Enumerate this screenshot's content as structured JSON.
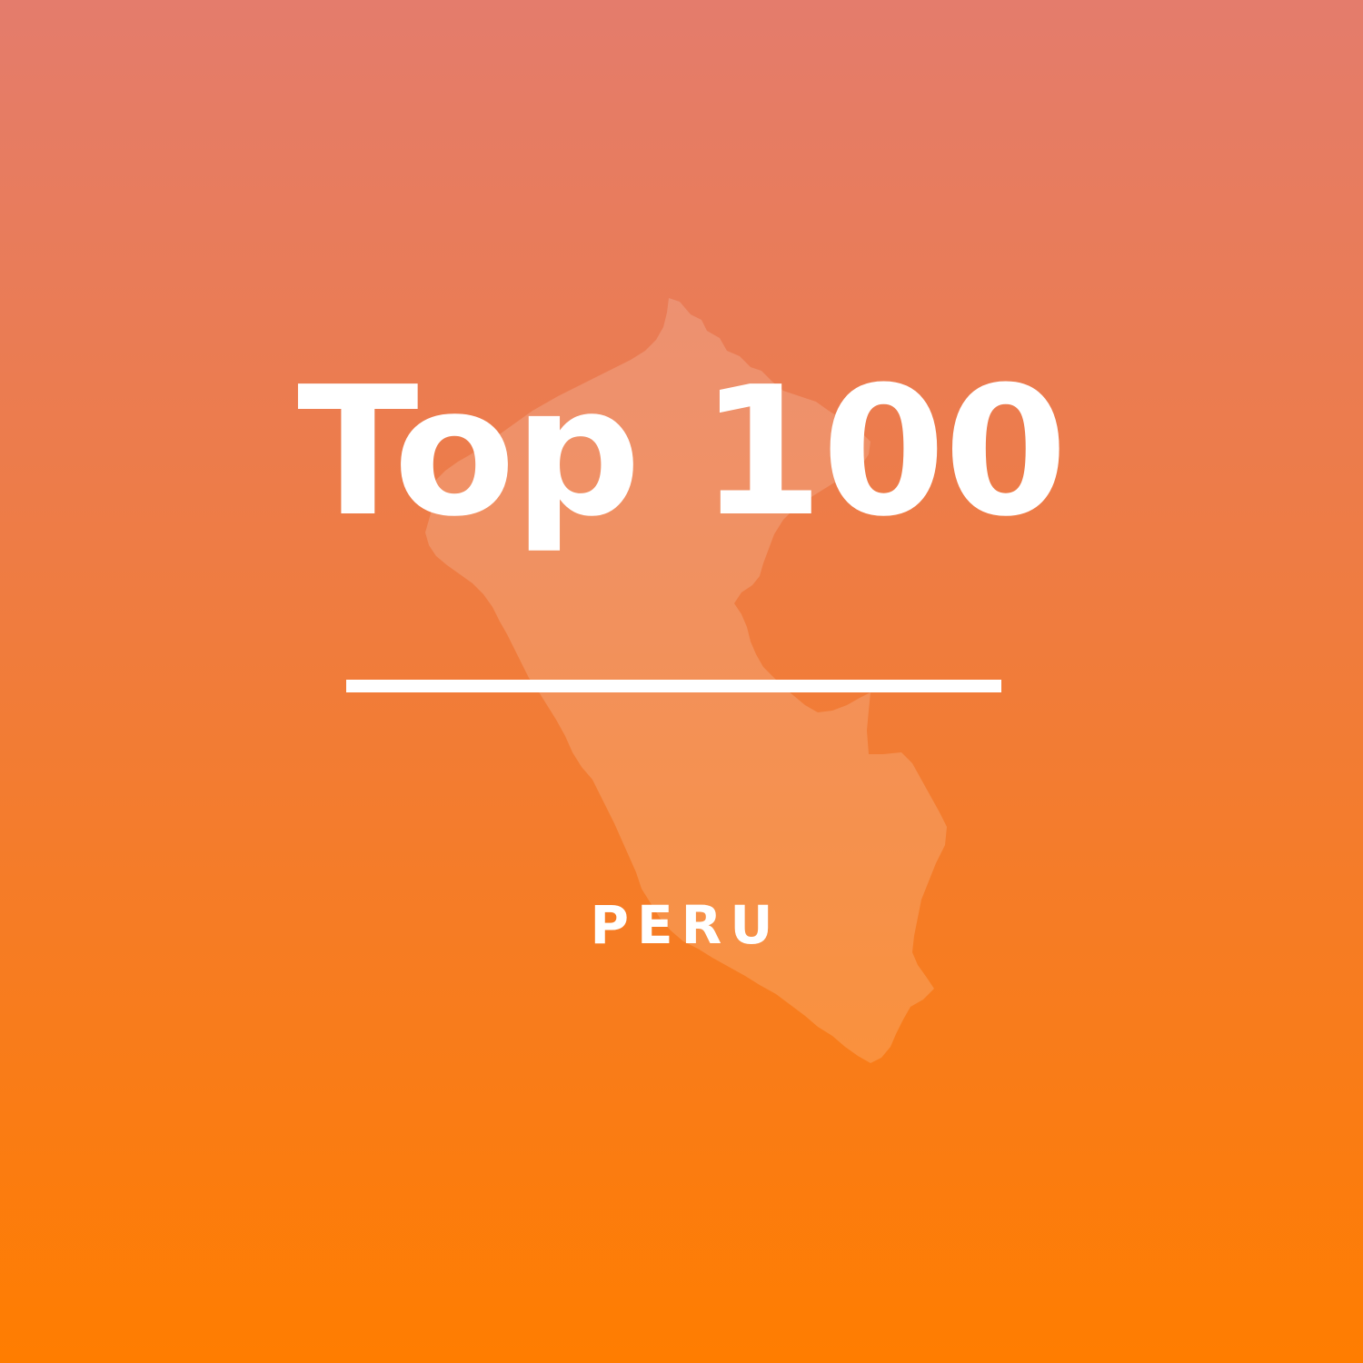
{
  "cover": {
    "title": "Top 100",
    "subtitle": "PERU",
    "map_icon": "peru-map-silhouette-icon",
    "colors": {
      "gradient_top": "#e47c6c",
      "gradient_bottom": "#ff7d00",
      "text": "#ffffff",
      "map_fill": "#ffffff"
    }
  }
}
